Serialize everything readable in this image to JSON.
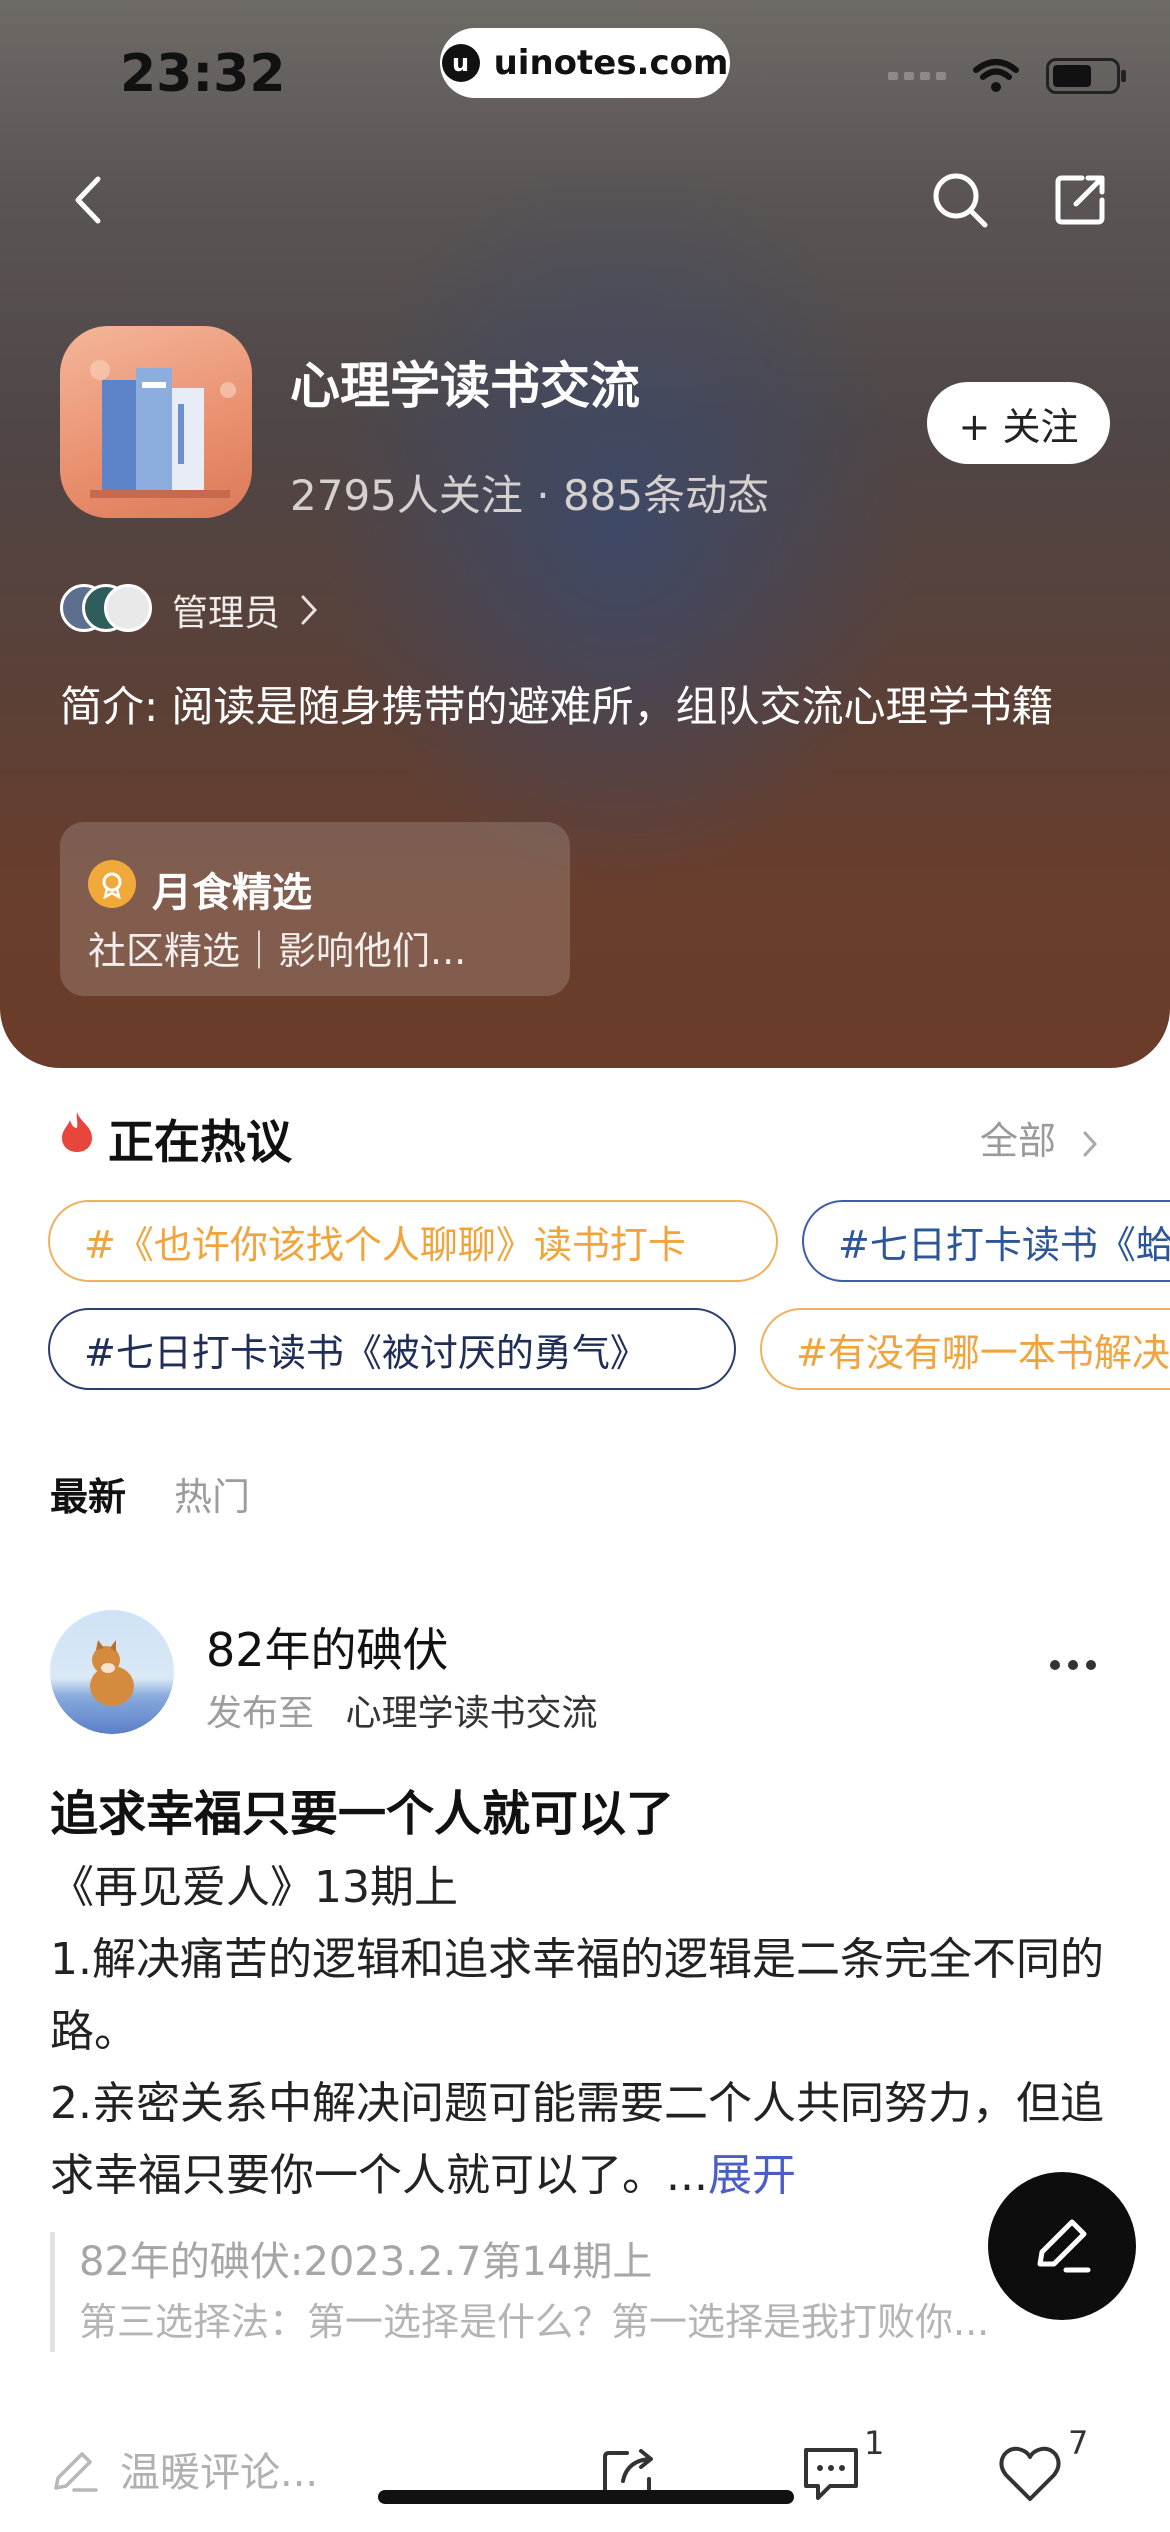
{
  "status_bar": {
    "time": "23:32",
    "url": "uinotes.com"
  },
  "group": {
    "name": "心理学读书交流",
    "stats": "2795人关注 · 885条动态",
    "follow_label": "+ 关注",
    "admin_label": "管理员",
    "intro": "简介: 阅读是随身携带的避难所，组队交流心理学书籍",
    "featured_title": "月食精选",
    "featured_sub": "社区精选｜影响他们..."
  },
  "hot": {
    "title": "正在热议",
    "all_label": "全部",
    "topics": [
      "#《也许你该找个人聊聊》读书打卡",
      "#七日打卡读书《蛤",
      "#七日打卡读书《被讨厌的勇气》",
      "#有没有哪一本书解决"
    ]
  },
  "tabs": {
    "latest": "最新",
    "hot": "热门"
  },
  "post": {
    "author": "82年的碘伏",
    "meta_prefix": "发布至",
    "meta_group": "心理学读书交流",
    "title": "追求幸福只要一个人就可以了",
    "body_line1": "《再见爱人》13期上",
    "body_line2": "1.解决痛苦的逻辑和追求幸福的逻辑是二条完全不同的路。",
    "body_line3": "2.亲密关系中解决问题可能需要二个人共同努力，但追求幸福只要你一个人就可以了。...",
    "expand_label": "展开",
    "quote_line1": "82年的碘伏:2023.2.7第14期上",
    "quote_line2": "第三选择法：第一选择是什么？第一选择是我打败你..."
  },
  "actions": {
    "comment_placeholder": "温暖评论...",
    "comment_count": "1",
    "like_count": "7"
  },
  "colors": {
    "accent_orange": "#f0a43b",
    "accent_blue": "#2d5698",
    "link": "#4a5ec6",
    "hot_flame": "#e8453c"
  }
}
